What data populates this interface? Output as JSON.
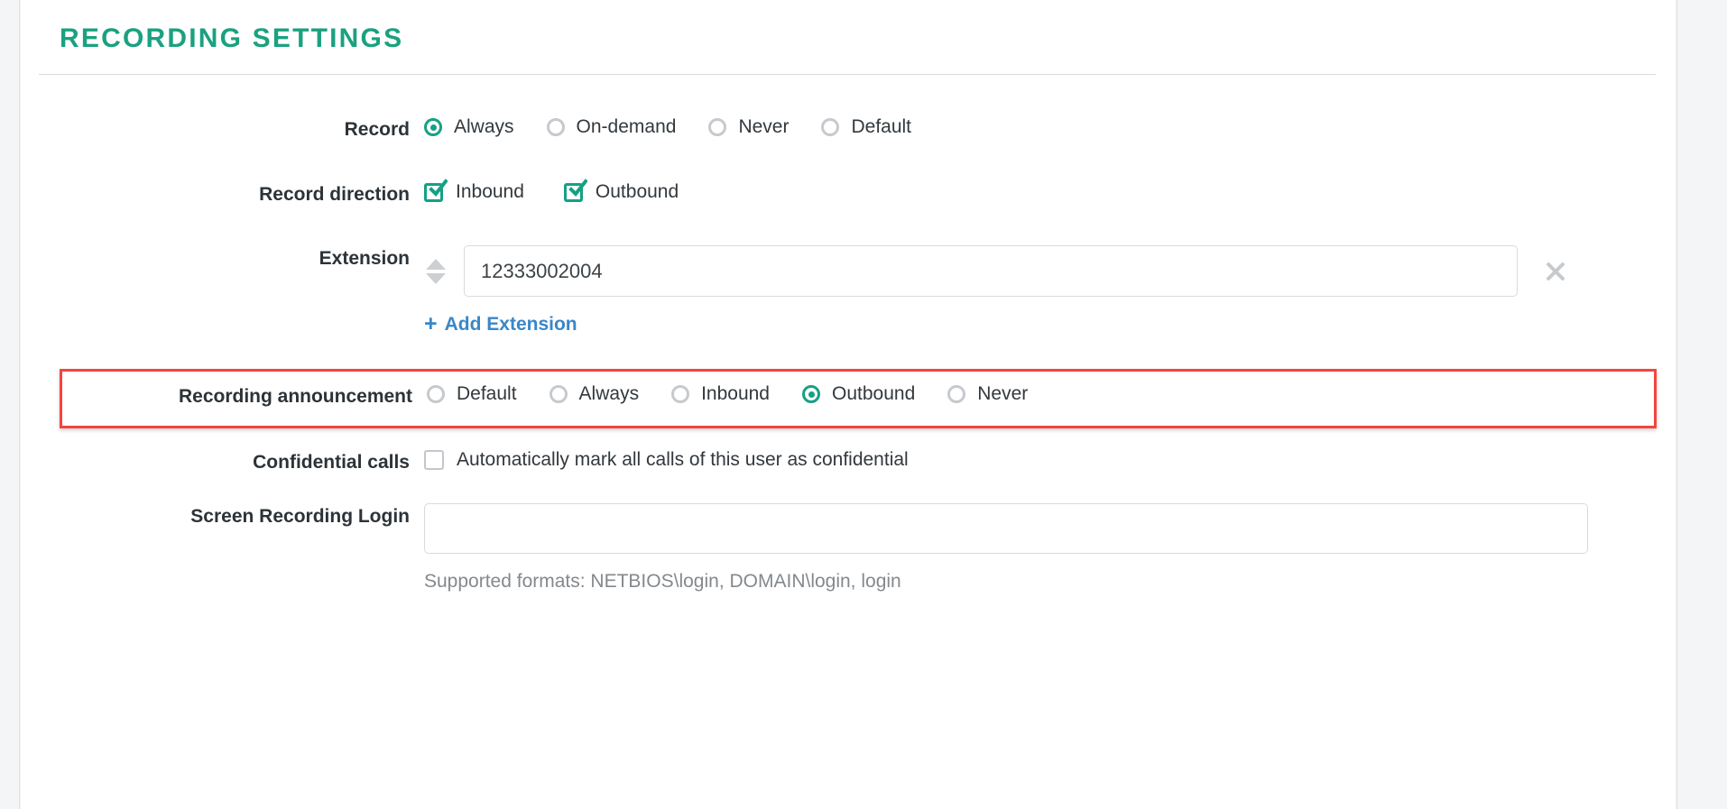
{
  "section": {
    "title": "RECORDING SETTINGS"
  },
  "colors": {
    "accent_teal": "#16a085",
    "title_teal": "#1aa180",
    "link_blue": "#3a87c8",
    "highlight_red": "#f4453c",
    "label_text": "#2c3338",
    "muted_text": "#83898e"
  },
  "rows": {
    "record": {
      "label": "Record",
      "selected": "Always",
      "options": [
        {
          "label": "Always",
          "selected": true
        },
        {
          "label": "On-demand",
          "selected": false
        },
        {
          "label": "Never",
          "selected": false
        },
        {
          "label": "Default",
          "selected": false
        }
      ]
    },
    "record_direction": {
      "label": "Record direction",
      "options": [
        {
          "label": "Inbound",
          "checked": true
        },
        {
          "label": "Outbound",
          "checked": true
        }
      ]
    },
    "extension": {
      "label": "Extension",
      "value": "12333002004",
      "placeholder": "",
      "sort_handle_icon": "sort-updown-icon",
      "remove_icon": "close-x-icon",
      "add_link": {
        "icon": "plus-icon",
        "plus": "+",
        "label": "Add Extension"
      }
    },
    "recording_announcement": {
      "label": "Recording announcement",
      "selected": "Outbound",
      "highlighted": true,
      "options": [
        {
          "label": "Default",
          "selected": false
        },
        {
          "label": "Always",
          "selected": false
        },
        {
          "label": "Inbound",
          "selected": false
        },
        {
          "label": "Outbound",
          "selected": true
        },
        {
          "label": "Never",
          "selected": false
        }
      ]
    },
    "confidential_calls": {
      "label": "Confidential calls",
      "checkbox": {
        "label": "Automatically mark all calls of this user as confidential",
        "checked": false
      }
    },
    "screen_recording_login": {
      "label": "Screen Recording Login",
      "value": "",
      "placeholder": "",
      "helper": "Supported formats: NETBIOS\\login, DOMAIN\\login, login"
    }
  }
}
